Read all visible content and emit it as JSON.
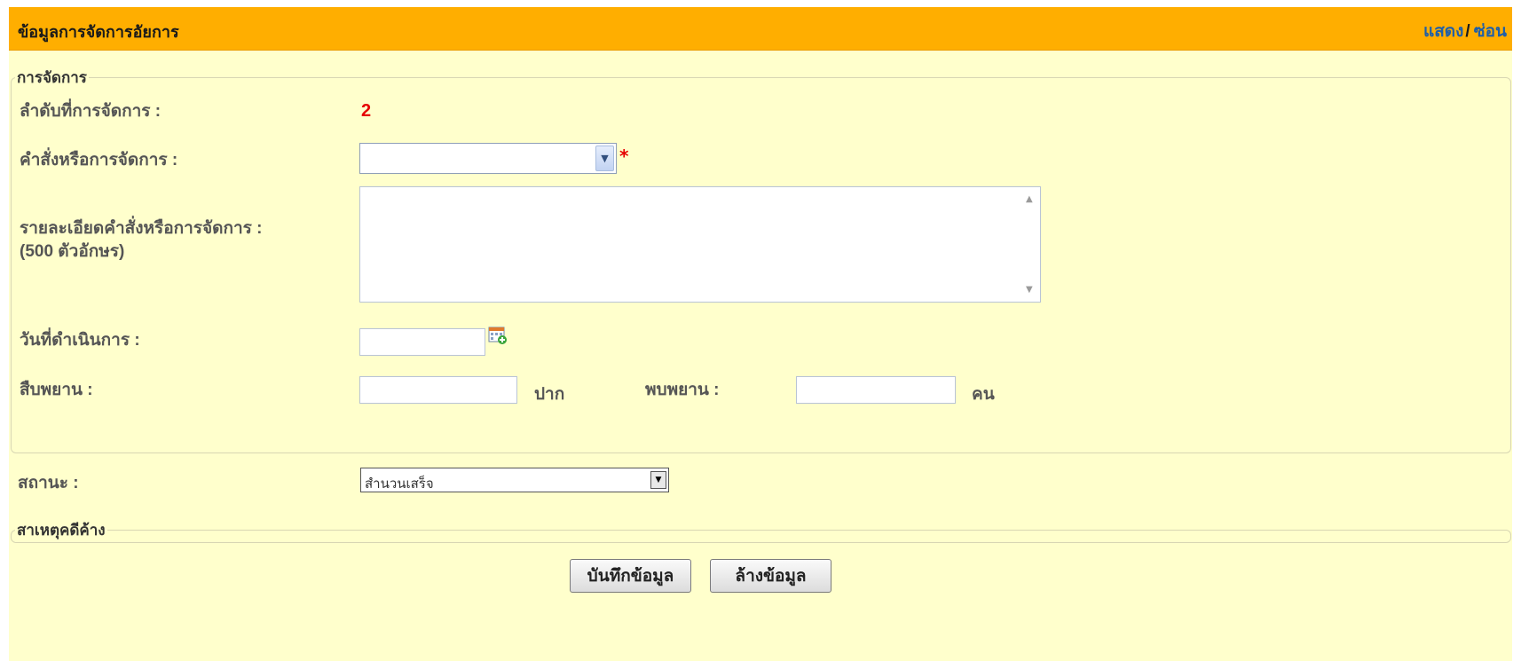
{
  "header": {
    "title": "ข้อมูลการจัดการอัยการ",
    "show_link": "แสดง",
    "separator": "/",
    "hide_link": "ซ่อน"
  },
  "management": {
    "legend": "การจัดการ",
    "sequence_label": "ลำดับที่การจัดการ :",
    "sequence_value": "2",
    "command_label": "คำสั่งหรือการจัดการ :",
    "command_value": "",
    "required_mark": "*",
    "detail_label_line1": "รายละเอียดคำสั่งหรือการจัดการ :",
    "detail_label_line2": "(500 ตัวอักษร)",
    "detail_value": "",
    "date_label": "วันที่ดำเนินการ :",
    "date_value": "",
    "witness_examine_label": "สืบพยาน :",
    "witness_examine_value": "",
    "witness_examine_unit": "ปาก",
    "witness_meet_label": "พบพยาน :",
    "witness_meet_value": "",
    "witness_meet_unit": "คน"
  },
  "status": {
    "label": "สถานะ :",
    "selected": "สำนวนเสร็จ"
  },
  "pending_reason": {
    "legend": "สาเหตุคดีค้าง"
  },
  "actions": {
    "save_label": "บันทึกข้อมูล",
    "clear_label": "ล้างข้อมูล"
  },
  "colors": {
    "header_bg": "#ffae00",
    "panel_bg": "#ffffcc",
    "link": "#1f5fa8",
    "required": "#e60000"
  }
}
